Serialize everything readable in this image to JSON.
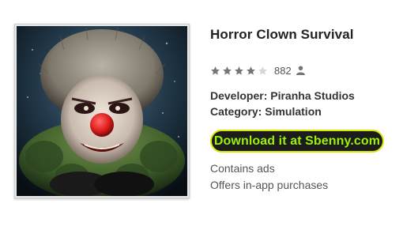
{
  "app": {
    "title": "Horror Clown Survival",
    "icon_name": "clown-app-icon",
    "rating": {
      "stars_filled": 4,
      "stars_total": 5,
      "count": "882",
      "count_icon": "person-icon"
    },
    "developer_line": "Developer: Piranha Studios",
    "category_line": "Category: Simulation",
    "download_label": "Download it at Sbenny.com",
    "contains_ads": "Contains ads",
    "in_app_purchases": "Offers in-app purchases"
  },
  "colors": {
    "star_filled": "#757575",
    "star_empty": "#d6d6d6",
    "button_bg": "#1c1c1c",
    "button_border": "#d8e800",
    "button_text": "#9cf00a",
    "clown_nose": "#e02020",
    "collar_green": "#3f5f2a"
  }
}
